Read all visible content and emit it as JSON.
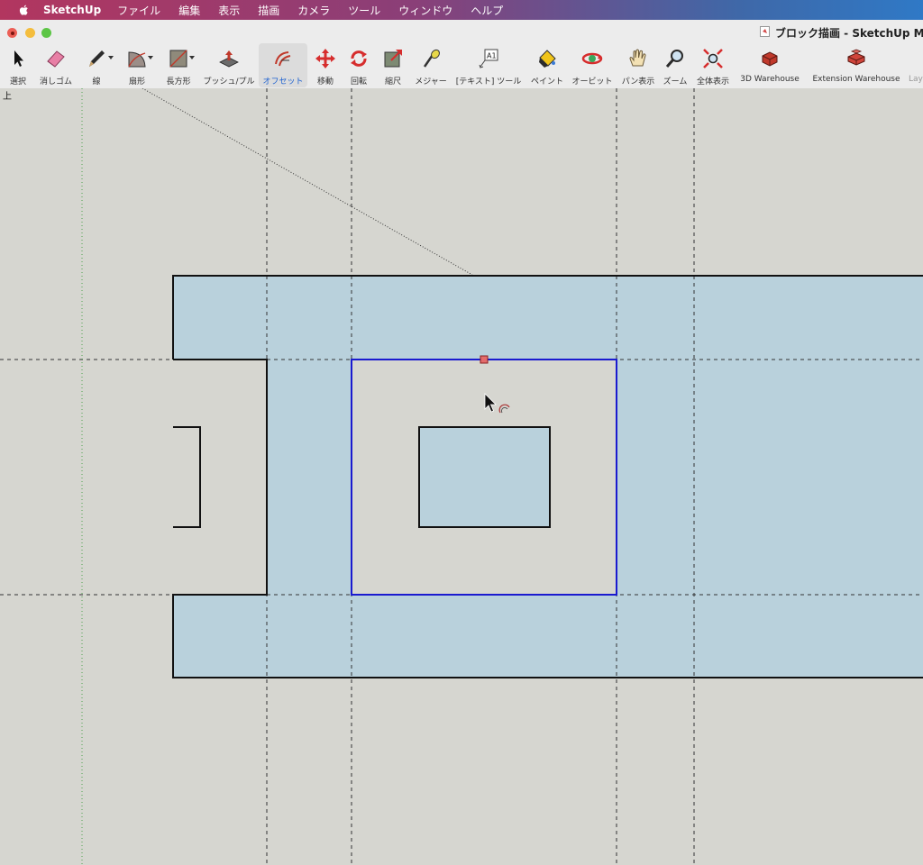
{
  "menubar": {
    "app": "SketchUp",
    "items": [
      "ファイル",
      "編集",
      "表示",
      "描画",
      "カメラ",
      "ツール",
      "ウィンドウ",
      "ヘルプ"
    ]
  },
  "window": {
    "title": "ブロック描画 - SketchUp Mak"
  },
  "toolbar": {
    "select": "選択",
    "eraser": "消しゴム",
    "line": "線",
    "arc": "扇形",
    "rectangle": "長方形",
    "pushpull": "プッシュ/プル",
    "offset": "オフセット",
    "move": "移動",
    "rotate": "回転",
    "scale": "縮尺",
    "tape": "メジャー",
    "text": "[テキスト] ツール",
    "paint": "ペイント",
    "orbit": "オービット",
    "pan": "パン表示",
    "zoom": "ズーム",
    "zoom_extents": "全体表示",
    "warehouse": "3D Warehouse",
    "ext_warehouse": "Extension Warehouse",
    "layers_partial": "Lay",
    "active_tool": "offset"
  },
  "viewport": {
    "view_label": "上",
    "face_color": "#b9d1dc",
    "background_color": "#d6d6d0",
    "selection_color": "#1a1acf",
    "text_tool_glyph": "A1"
  }
}
